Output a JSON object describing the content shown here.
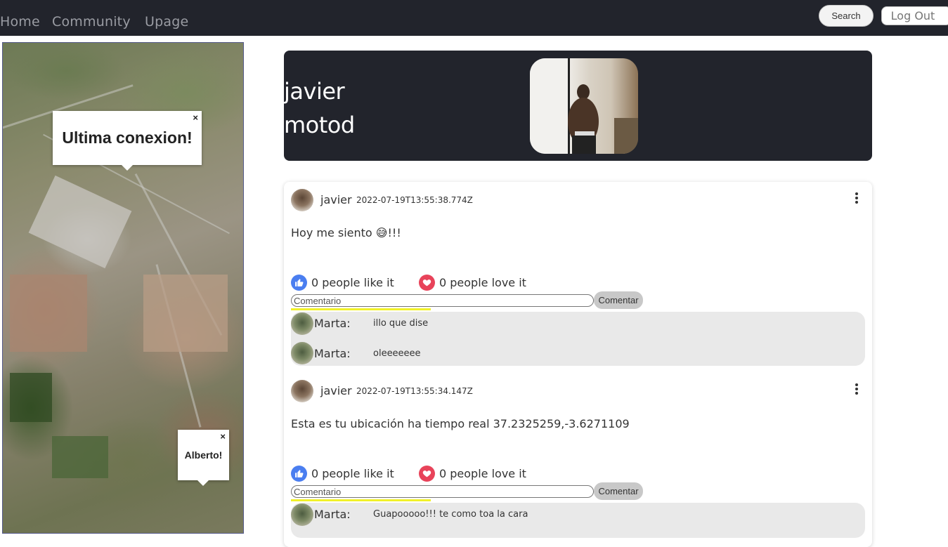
{
  "nav": {
    "links": [
      "Home",
      "Community",
      "Upage"
    ],
    "search_label": "Search",
    "logout_label": "Log Out"
  },
  "map": {
    "popup_main": "Ultima conexion!",
    "popup_secondary": "Alberto!",
    "close_glyph": "×"
  },
  "profile": {
    "first_name": "javier",
    "last_name": "motod"
  },
  "posts": [
    {
      "author": "javier",
      "timestamp": "2022-07-19T13:55:38.774Z",
      "text": "Hoy me siento 😅!!!",
      "likes_label": "0 people like it",
      "loves_label": "0 people love it",
      "comment_placeholder": "Comentario",
      "comment_button": "Comentar",
      "comments": [
        {
          "author": "Marta:",
          "text": "illo que dise"
        },
        {
          "author": "Marta:",
          "text": "oleeeeeee"
        }
      ]
    },
    {
      "author": "javier",
      "timestamp": "2022-07-19T13:55:34.147Z",
      "text": "Esta es tu ubicación ha tiempo real 37.2325259,-3.6271109",
      "likes_label": "0 people like it",
      "loves_label": "0 people love it",
      "comment_placeholder": "Comentario",
      "comment_button": "Comentar",
      "comments": [
        {
          "author": "Marta:",
          "text": "Guapooooo!!! te como toa la cara"
        }
      ]
    }
  ],
  "colors": {
    "nav_bg": "#22242c",
    "like_blue": "#4a7ef0",
    "love_red": "#e8435a",
    "highlight_yellow": "#f1f12a"
  }
}
